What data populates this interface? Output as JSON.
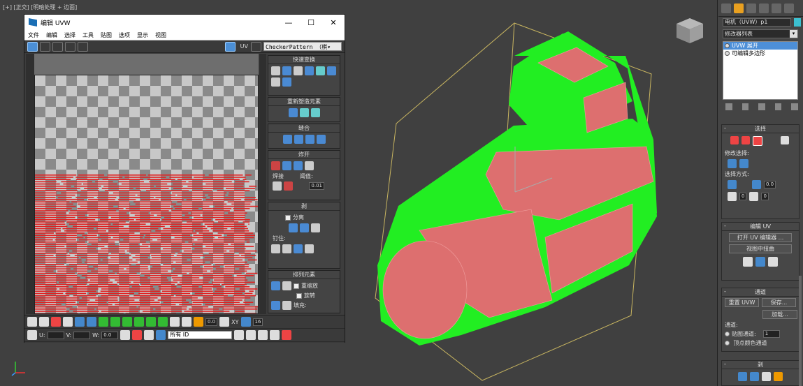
{
  "viewport": {
    "label": "[+] [正交] [明暗处理 + 边面]",
    "mesh_color": "#22ee22",
    "face_color": "#dd6f6f",
    "bbox_color": "#c8b560"
  },
  "uv_editor": {
    "title": "编辑 UVW",
    "window_controls": [
      "—",
      "☐",
      "✕"
    ],
    "menu": [
      "文件",
      "编辑",
      "选择",
      "工具",
      "贴图",
      "选项",
      "显示",
      "视图"
    ],
    "mode_label": "UV",
    "texture_dropdown": "CheckerPattern （棋▾",
    "rollouts": {
      "quick_transform": "快速变换",
      "reshape": "重新塑造元素",
      "stitch": "缝合",
      "explode": "炸开",
      "weld": "焊接",
      "threshold_label": "阈值:",
      "threshold_value": "0.01",
      "peel": "剥",
      "detach": "分离",
      "pin": "钉住:",
      "arrange": "排列元素",
      "rescale": "重缩放",
      "rotate": "旋转",
      "padding": "填充:"
    },
    "bottom": {
      "value1": "0.0",
      "axis": "XY",
      "value2": "16",
      "u_label": "U:",
      "v_label": "V:",
      "w_label": "W:",
      "w_value": "0.0",
      "id_select": "所有 ID"
    },
    "stripe_color": "#e02020"
  },
  "command_panel": {
    "object_name": "电机（UVW）p1",
    "modifier_list": "修改器列表",
    "stack": [
      "UVW 展开",
      "可编辑多边形"
    ],
    "selection": {
      "title": "选择",
      "modify_selection": "修改选择:",
      "selection_mode": "选择方式:",
      "value1": "0.0",
      "value2": "0",
      "value3": "0"
    },
    "edit_uv": {
      "title": "编辑 UV",
      "open_editor": "打开 UV 编辑器 ...",
      "tweak": "视图中扭曲"
    },
    "channel": {
      "title": "通道",
      "reset": "重置 UVW",
      "save": "保存...",
      "load": "加载...",
      "channel_label": "通道:",
      "map_channel": "贴图通道:",
      "map_channel_value": "1",
      "vertex_color": "顶点颜色通道"
    },
    "peel": {
      "title": "剥"
    }
  }
}
